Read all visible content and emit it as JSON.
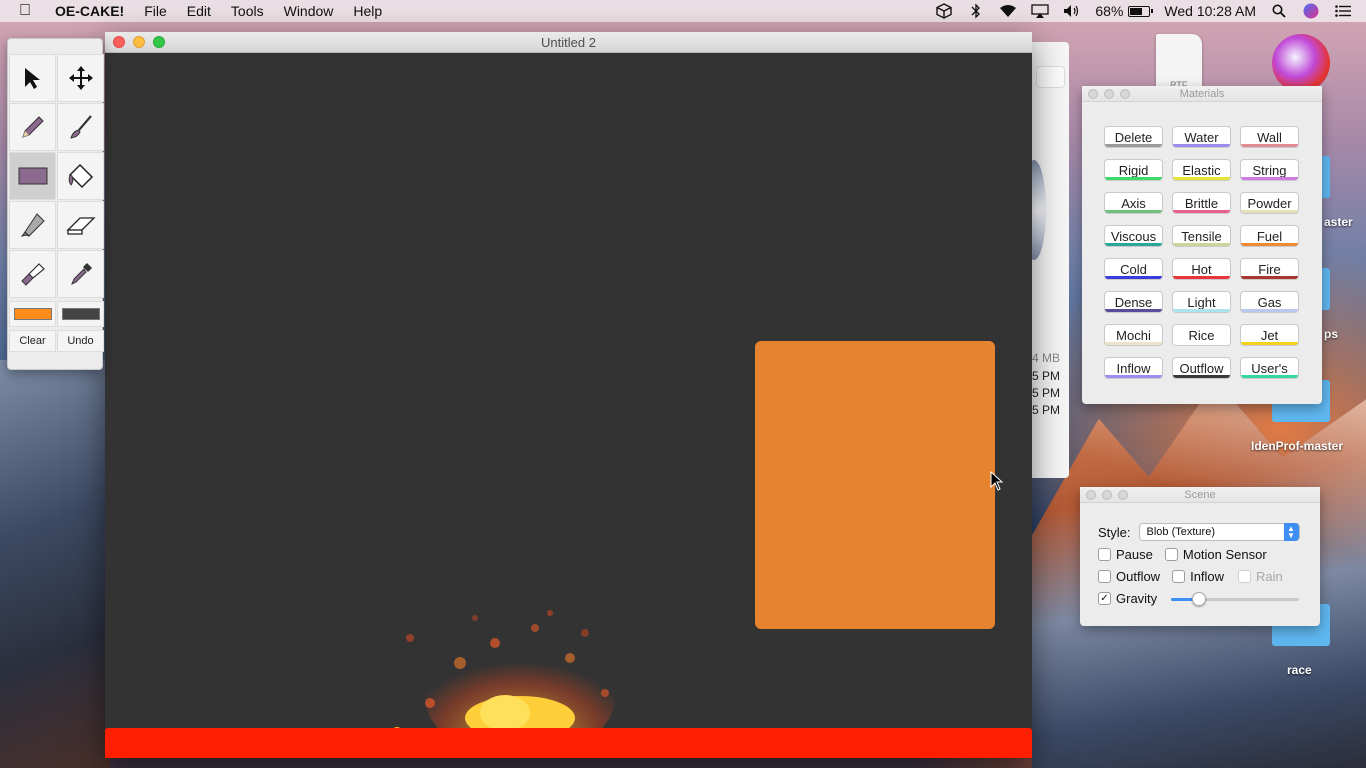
{
  "menubar": {
    "app_name": "OE-CAKE!",
    "menus": [
      "File",
      "Edit",
      "Tools",
      "Window",
      "Help"
    ],
    "battery_percent": "68%",
    "battery_level": 0.68,
    "clock": "Wed 10:28 AM"
  },
  "tools_palette": {
    "tools": [
      "select-arrow",
      "move",
      "pencil",
      "brush",
      "rectangle",
      "fill-bucket",
      "knife",
      "eraser",
      "flashlight",
      "dropper"
    ],
    "active_tool": "rectangle",
    "primary_color": "#ff8c1a",
    "secondary_color": "#444444",
    "clear_label": "Clear",
    "undo_label": "Undo"
  },
  "main_window": {
    "title": "Untitled 2"
  },
  "background_window": {
    "size_text": "4 MB",
    "times": [
      "5 PM",
      "5 PM",
      "5 PM"
    ]
  },
  "desktop": {
    "labels": [
      "aster",
      "ps",
      "IdenProf-master",
      "race"
    ]
  },
  "materials": {
    "title": "Materials",
    "items": [
      {
        "label": "Delete",
        "color": "#9a9a9a"
      },
      {
        "label": "Water",
        "color": "#9b8cf0"
      },
      {
        "label": "Wall",
        "color": "#e08a92"
      },
      {
        "label": "Rigid",
        "color": "#3ed96a"
      },
      {
        "label": "Elastic",
        "color": "#e5e534"
      },
      {
        "label": "String",
        "color": "#d07ae6"
      },
      {
        "label": "Axis",
        "color": "#6dc07e"
      },
      {
        "label": "Brittle",
        "color": "#e8608a"
      },
      {
        "label": "Powder",
        "color": "#e8e0b8"
      },
      {
        "label": "Viscous",
        "color": "#2aa79a"
      },
      {
        "label": "Tensile",
        "color": "#c9d69a"
      },
      {
        "label": "Fuel",
        "color": "#ef8a34"
      },
      {
        "label": "Cold",
        "color": "#3b3bdc"
      },
      {
        "label": "Hot",
        "color": "#e8343a"
      },
      {
        "label": "Fire",
        "color": "#a8362e"
      },
      {
        "label": "Dense",
        "color": "#5c4b9a"
      },
      {
        "label": "Light",
        "color": "#a8e6ec"
      },
      {
        "label": "Gas",
        "color": "#b8c8ee"
      },
      {
        "label": "Mochi",
        "color": "#ece4c8"
      },
      {
        "label": "Rice",
        "color": "#ffffff"
      },
      {
        "label": "Jet",
        "color": "#f2d21e"
      },
      {
        "label": "Inflow",
        "color": "#9c8cf0"
      },
      {
        "label": "Outflow",
        "color": "#3a3a3a"
      },
      {
        "label": "User's",
        "color": "#36d6a0"
      }
    ]
  },
  "scene": {
    "title": "Scene",
    "style_label": "Style:",
    "style_value": "Blob (Texture)",
    "pause_label": "Pause",
    "pause_checked": false,
    "motion_label": "Motion Sensor",
    "motion_checked": false,
    "outflow_label": "Outflow",
    "outflow_checked": false,
    "inflow_label": "Inflow",
    "inflow_checked": false,
    "rain_label": "Rain",
    "rain_checked": false,
    "gravity_label": "Gravity",
    "gravity_checked": true,
    "gravity_level": 0.22
  }
}
